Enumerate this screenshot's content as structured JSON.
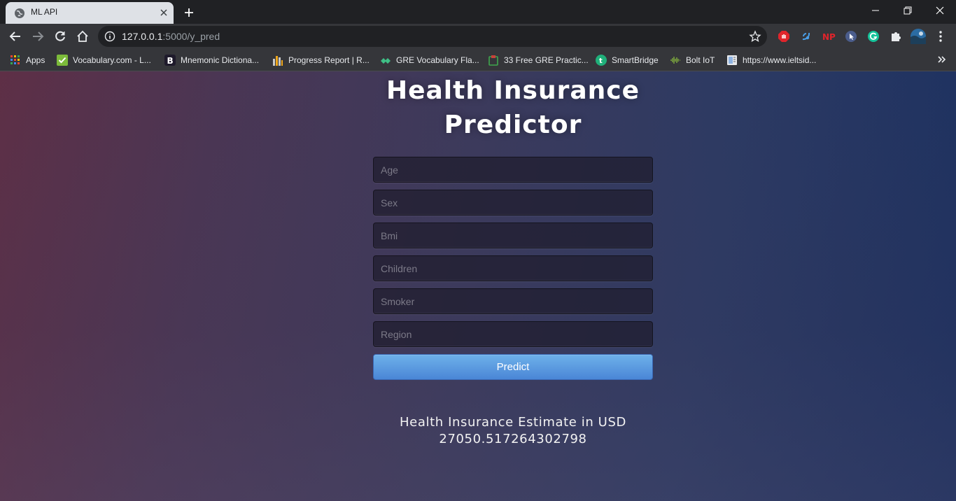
{
  "browser": {
    "tab": {
      "title": "ML API"
    },
    "address_bar": {
      "host": "127.0.0.1",
      "path": ":5000/y_pred"
    },
    "bookmarks": [
      {
        "label": "Apps",
        "icon": "apps-grid-icon"
      },
      {
        "label": "Vocabulary.com - L...",
        "icon": "vocabulary-check-icon"
      },
      {
        "label": "Mnemonic Dictiona...",
        "icon": "mnemonic-b-icon"
      },
      {
        "label": "Progress Report | R...",
        "icon": "progress-report-icon"
      },
      {
        "label": "GRE Vocabulary Fla...",
        "icon": "gre-flashcards-icon"
      },
      {
        "label": "33 Free GRE Practic...",
        "icon": "gre-practice-icon"
      },
      {
        "label": "SmartBridge",
        "icon": "smartbridge-icon"
      },
      {
        "label": "Bolt IoT",
        "icon": "bolt-iot-icon"
      },
      {
        "label": "https://www.ieltsid...",
        "icon": "page-icon"
      }
    ],
    "extensions": [
      "adblock-icon",
      "audio-extension-icon",
      "np-extension-icon",
      "cursor-extension-icon",
      "grammarly-icon",
      "puzzle-icon",
      "profile-avatar-icon",
      "menu-dots-icon"
    ]
  },
  "app": {
    "title": "Health Insurance Predictor",
    "fields": [
      {
        "name": "age",
        "placeholder": "Age"
      },
      {
        "name": "sex",
        "placeholder": "Sex"
      },
      {
        "name": "bmi",
        "placeholder": "Bmi"
      },
      {
        "name": "children",
        "placeholder": "Children"
      },
      {
        "name": "smoker",
        "placeholder": "Smoker"
      },
      {
        "name": "region",
        "placeholder": "Region"
      }
    ],
    "submit_label": "Predict",
    "result_label": "Health Insurance Estimate in USD",
    "result_value": "27050.517264302798"
  },
  "colors": {
    "button_top": "#6eb1ea",
    "button_bottom": "#4a86d6",
    "background_left": "#5e2f46",
    "background_right": "#1b3060"
  }
}
